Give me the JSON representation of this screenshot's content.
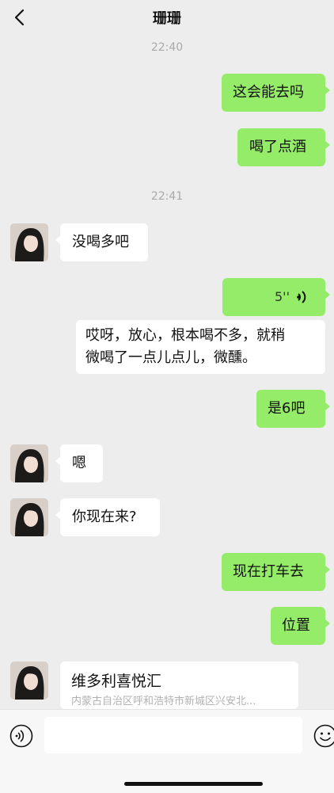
{
  "header": {
    "title": "珊珊",
    "back_icon": "chevron-left-icon"
  },
  "timestamps": [
    "22:40",
    "22:41"
  ],
  "messages": [
    {
      "from": "me",
      "text": "这会能去吗"
    },
    {
      "from": "me",
      "text": "喝了点酒"
    },
    {
      "from": "other",
      "text": "没喝多吧"
    },
    {
      "from": "me",
      "type": "voice",
      "duration": "5''"
    },
    {
      "from": "other",
      "type": "transcript",
      "line1": "哎呀，放心，根本喝不多，就稍",
      "line2": "微喝了一点儿点儿，微醺。"
    },
    {
      "from": "me",
      "text": "是6吧"
    },
    {
      "from": "other",
      "text": "嗯"
    },
    {
      "from": "other",
      "text": "你现在来?"
    },
    {
      "from": "me",
      "text": "现在打车去"
    },
    {
      "from": "me",
      "text": "位置"
    },
    {
      "from": "other",
      "type": "location",
      "name": "维多利喜悦汇",
      "address": "内蒙古自治区呼和浩特市新城区兴安北..."
    }
  ],
  "input_bar": {
    "voice_icon": "voice-input-icon",
    "emoji_icon": "emoji-icon"
  },
  "colors": {
    "me_bubble": "#95ec69",
    "other_bubble": "#ffffff",
    "background": "#ededed"
  }
}
